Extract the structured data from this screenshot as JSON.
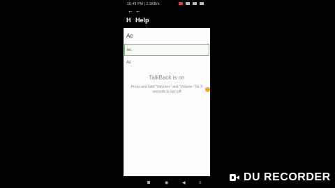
{
  "status_bar": {
    "time": "10:49 PM | 1.9KB/s"
  },
  "toolbar": {
    "back_small": "←",
    "back_large": "←",
    "h_letter": "H",
    "title": "Help"
  },
  "content": {
    "first_row": "Ac",
    "field_value": "tec",
    "second_row": "Ac",
    "talkback_title": "TalkBack is on",
    "talkback_message": "Press and hold \"Volume+\" and \"Volume-\" for 5 seconds to turn off"
  },
  "nav_bar": {
    "menu": "≡",
    "home": "◉",
    "back": "◀"
  },
  "watermark": {
    "label": "DU RECORDER"
  },
  "colors": {
    "focus_border": "#66bb6a",
    "overlay_bubble": "#f5a623",
    "background": "#000000"
  }
}
